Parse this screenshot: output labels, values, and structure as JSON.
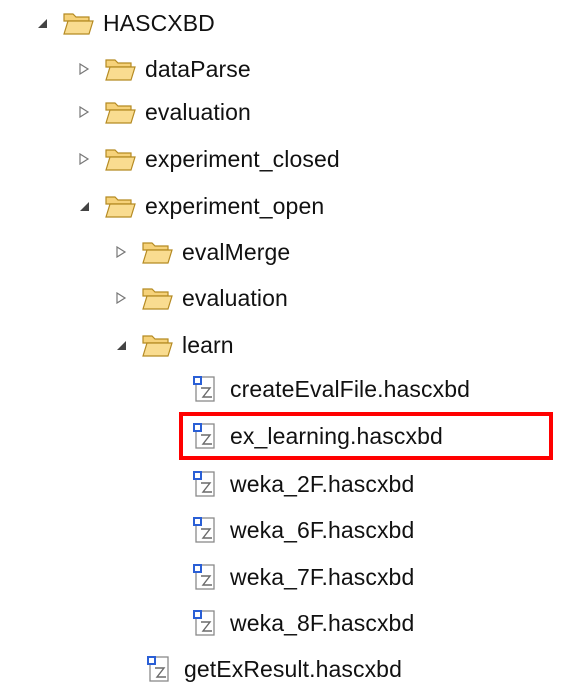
{
  "tree": {
    "root": {
      "label": "HASCXBD",
      "expanded": true,
      "icon": "folder-open-icon"
    },
    "items": [
      {
        "id": "dataParse",
        "label": "dataParse",
        "type": "folder",
        "expanded": false
      },
      {
        "id": "evaluation",
        "label": "evaluation",
        "type": "folder",
        "expanded": false
      },
      {
        "id": "experiment_closed",
        "label": "experiment_closed",
        "type": "folder",
        "expanded": false
      },
      {
        "id": "experiment_open",
        "label": "experiment_open",
        "type": "folder",
        "expanded": true
      },
      {
        "id": "evalMerge",
        "label": "evalMerge",
        "type": "folder",
        "expanded": false
      },
      {
        "id": "evaluation2",
        "label": "evaluation",
        "type": "folder",
        "expanded": false
      },
      {
        "id": "learn",
        "label": "learn",
        "type": "folder",
        "expanded": true
      },
      {
        "id": "createEvalFile",
        "label": "createEvalFile.hascxbd",
        "type": "file"
      },
      {
        "id": "ex_learning",
        "label": "ex_learning.hascxbd",
        "type": "file",
        "highlighted": true
      },
      {
        "id": "weka_2F",
        "label": "weka_2F.hascxbd",
        "type": "file"
      },
      {
        "id": "weka_6F",
        "label": "weka_6F.hascxbd",
        "type": "file"
      },
      {
        "id": "weka_7F",
        "label": "weka_7F.hascxbd",
        "type": "file"
      },
      {
        "id": "weka_8F",
        "label": "weka_8F.hascxbd",
        "type": "file"
      },
      {
        "id": "getExResult",
        "label": "getExResult.hascxbd",
        "type": "file"
      }
    ]
  },
  "colors": {
    "highlight_border": "#ff0000",
    "folder_fill": "#f6c760",
    "folder_stroke": "#b58a22",
    "toggle": "#555555",
    "file_blue": "#2a5fd6"
  }
}
